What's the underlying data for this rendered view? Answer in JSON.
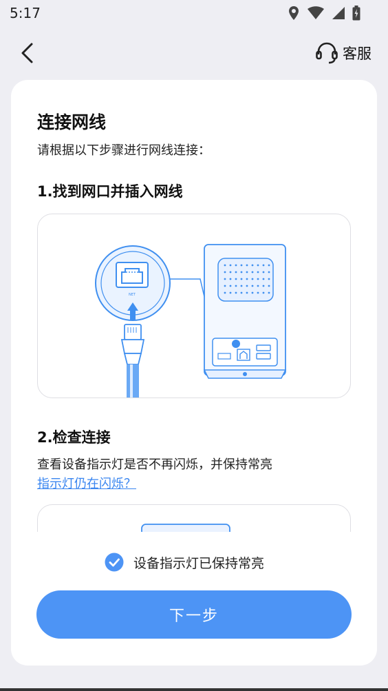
{
  "status_bar": {
    "time": "5:17"
  },
  "header": {
    "service_label": "客服"
  },
  "main": {
    "title": "连接网线",
    "subtitle": "请根据以下步骤进行网线连接：",
    "step1": {
      "title": "1.找到网口并插入网线",
      "port_label": "NET"
    },
    "step2": {
      "title": "2.检查连接",
      "description": "查看设备指示灯是否不再闪烁，并保持常亮",
      "help_link": "指示灯仍在闪烁？"
    },
    "confirm": {
      "label": "设备指示灯已保持常亮",
      "checked": true
    },
    "next_button": "下一步"
  },
  "colors": {
    "accent": "#4d94f5",
    "link": "#3a86f0",
    "illustration_blue": "#3f8ff0"
  },
  "icons": [
    "location-icon",
    "wifi-icon",
    "signal-icon",
    "battery-icon",
    "back-arrow-icon",
    "headset-icon",
    "checkmark-icon"
  ]
}
